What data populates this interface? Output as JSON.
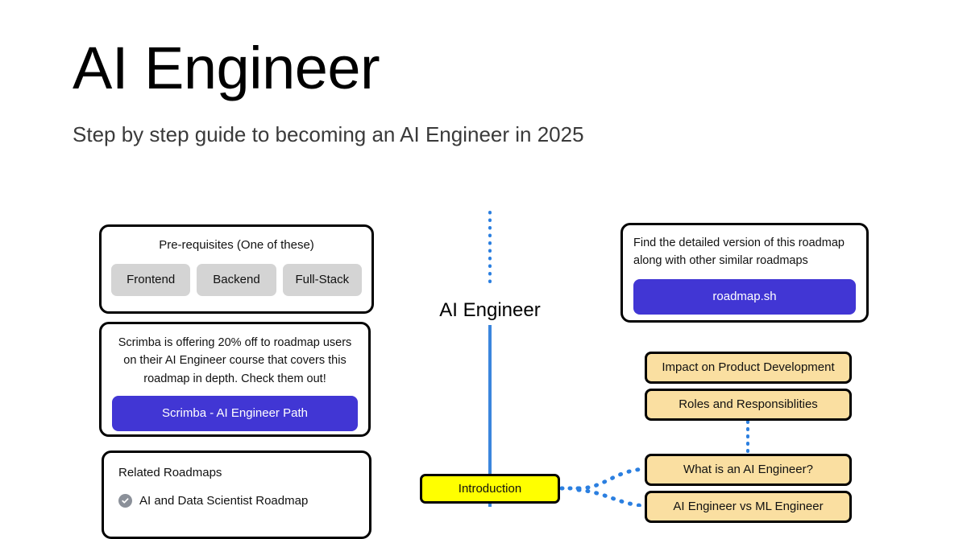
{
  "header": {
    "title": "AI Engineer",
    "subtitle": "Step by step guide to becoming an AI Engineer in 2025"
  },
  "colors": {
    "node_fill": "#FADFA1",
    "node_primary_fill": "#FFFF00",
    "node_border": "#000000",
    "button_accent": "#4136D4",
    "connector_blue": "#2B7FE0",
    "chip_gray": "#D4D4D4",
    "check_badge_gray": "#8B9099"
  },
  "prerequisites": {
    "title": "Pre-requisites (One of these)",
    "options": [
      "Frontend",
      "Backend",
      "Full-Stack"
    ]
  },
  "scrimba_promo": {
    "text": "Scrimba is offering 20% off to roadmap users on their AI Engineer course that covers this roadmap in depth. Check them out!",
    "button_label": "Scrimba - AI Engineer Path"
  },
  "related_roadmaps": {
    "title": "Related Roadmaps",
    "items": [
      {
        "label": "AI and Data Scientist Roadmap",
        "icon": "check-circle-icon"
      }
    ]
  },
  "roadmapsh_promo": {
    "text": "Find the detailed version of this roadmap along with other similar roadmaps",
    "button_label": "roadmap.sh"
  },
  "center_label": "AI Engineer",
  "nodes": [
    {
      "id": "impact",
      "label": "Impact on Product Development",
      "style": "secondary"
    },
    {
      "id": "roles",
      "label": "Roles and Responsiblities",
      "style": "secondary"
    },
    {
      "id": "what-is",
      "label": "What is an AI Engineer?",
      "style": "secondary"
    },
    {
      "id": "vs-ml",
      "label": "AI Engineer vs ML Engineer",
      "style": "secondary"
    },
    {
      "id": "introduction",
      "label": "Introduction",
      "style": "primary"
    }
  ]
}
